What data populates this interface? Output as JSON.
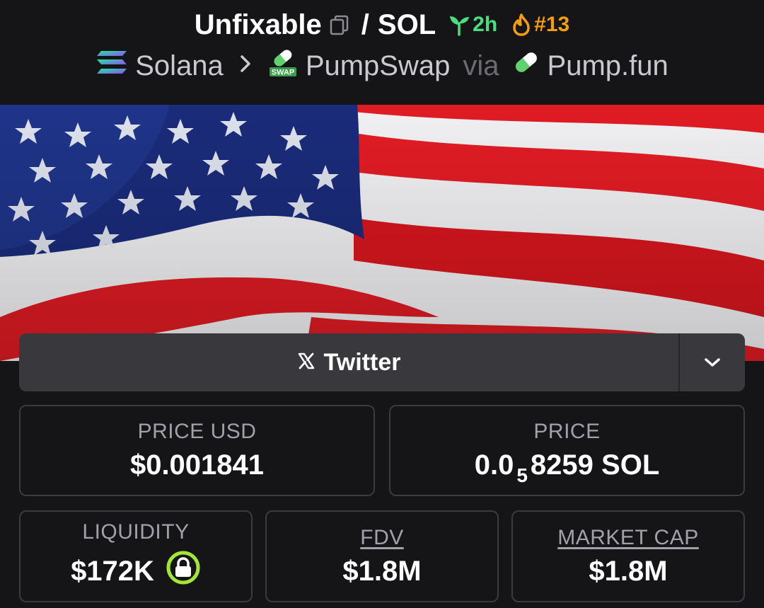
{
  "header": {
    "token_name": "Unfixable",
    "slash": "/",
    "quote_token": "SOL",
    "age": "2h",
    "rank": "#13",
    "chain": "Solana",
    "dex": "PumpSwap",
    "dex_badge": "SWAP",
    "via": "via",
    "launchpad": "Pump.fun"
  },
  "social": {
    "twitter_label": "Twitter"
  },
  "stats": {
    "price_usd_label": "PRICE USD",
    "price_usd_value": "$0.001841",
    "price_label": "PRICE",
    "price_prefix": "0.0",
    "price_sub": "5",
    "price_suffix": "8259 SOL",
    "liquidity_label": "LIQUIDITY",
    "liquidity_value": "$172K",
    "fdv_label": "FDV",
    "fdv_value": "$1.8M",
    "mcap_label": "MARKET CAP",
    "mcap_value": "$1.8M"
  },
  "colors": {
    "background": "#151518",
    "age_green": "#4ade80",
    "rank_orange": "#f59e0b",
    "lock_green": "#a3e635"
  },
  "icons": [
    "copy-icon",
    "sprout-icon",
    "flame-icon",
    "solana-icon",
    "chevron-right-icon",
    "pumpswap-icon",
    "pill-icon",
    "x-logo-icon",
    "chevron-down-icon",
    "lock-icon"
  ]
}
